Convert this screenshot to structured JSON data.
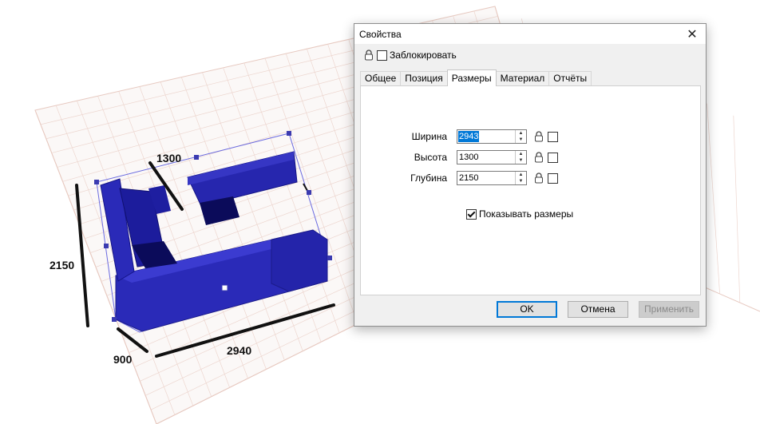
{
  "scene": {
    "dimension_labels": {
      "depth_top": "1300",
      "height_left": "2150",
      "depth_bottom": "900",
      "width_bottom": "2940"
    },
    "colors": {
      "furniture": "#2020b0",
      "furniture_dark": "#0c0c66",
      "grid": "#e7c9c0",
      "selection_outline": "#5a5ad6"
    }
  },
  "dialog": {
    "title": "Свойства",
    "lock_label": "Заблокировать",
    "tabs": [
      {
        "label": "Общее"
      },
      {
        "label": "Позиция"
      },
      {
        "label": "Размеры"
      },
      {
        "label": "Материал"
      },
      {
        "label": "Отчёты"
      }
    ],
    "active_tab": "Размеры",
    "fields": {
      "width": {
        "label": "Ширина",
        "value": "2943"
      },
      "height": {
        "label": "Высота",
        "value": "1300"
      },
      "depth": {
        "label": "Глубина",
        "value": "2150"
      }
    },
    "show_dims_label": "Показывать размеры",
    "buttons": {
      "ok": "OK",
      "cancel": "Отмена",
      "apply": "Применить"
    },
    "colors": {
      "accent": "#0078d7"
    }
  }
}
